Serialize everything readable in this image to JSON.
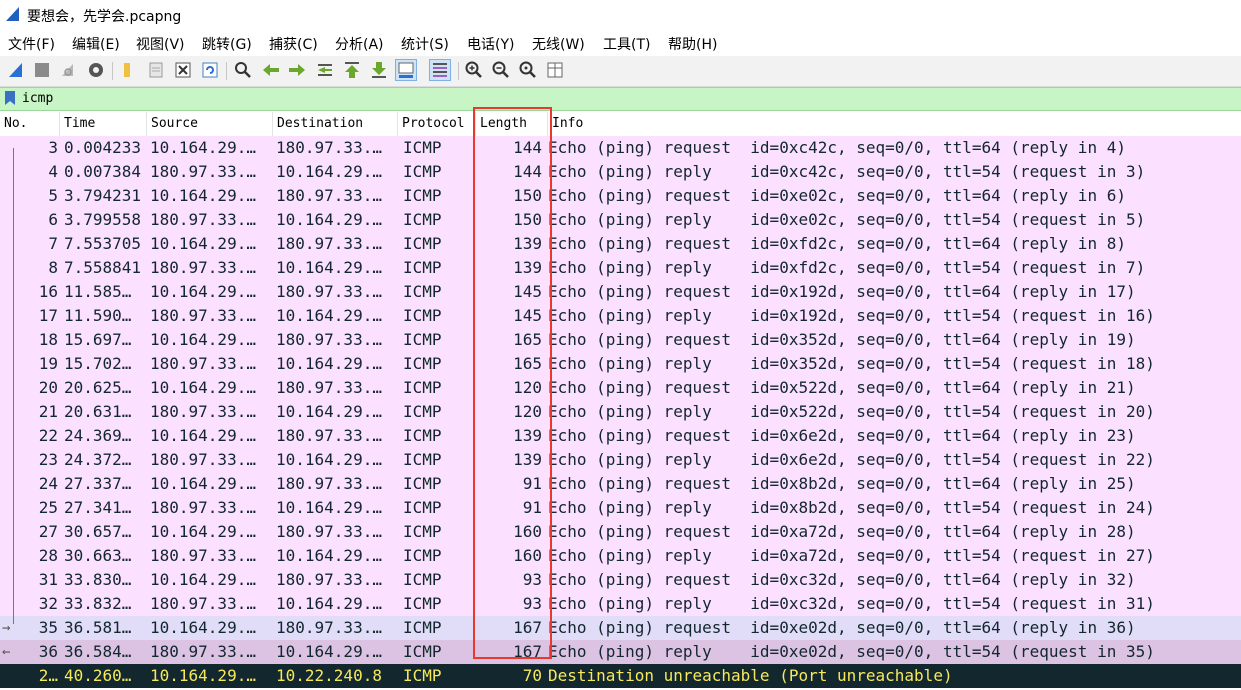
{
  "window": {
    "title": "要想会，先学会.pcapng",
    "icon": "wireshark-fin-icon"
  },
  "menu": [
    {
      "label": "文件(F)"
    },
    {
      "label": "编辑(E)"
    },
    {
      "label": "视图(V)"
    },
    {
      "label": "跳转(G)"
    },
    {
      "label": "捕获(C)"
    },
    {
      "label": "分析(A)"
    },
    {
      "label": "统计(S)"
    },
    {
      "label": "电话(Y)"
    },
    {
      "label": "无线(W)"
    },
    {
      "label": "工具(T)"
    },
    {
      "label": "帮助(H)"
    }
  ],
  "toolbar": {
    "icons": [
      "start-capture-icon",
      "stop-capture-icon",
      "restart-capture-icon",
      "capture-options-icon",
      "open-file-icon",
      "save-file-icon",
      "close-file-icon",
      "reload-file-icon",
      "find-packet-icon",
      "go-back-icon",
      "go-forward-icon",
      "go-to-packet-icon",
      "first-packet-icon",
      "last-packet-icon",
      "auto-scroll-icon",
      "colorize-icon",
      "zoom-in-icon",
      "zoom-out-icon",
      "zoom-normal-icon",
      "resize-columns-icon"
    ]
  },
  "filter": {
    "value": "icmp",
    "icon": "bookmark-icon"
  },
  "columns": {
    "no": "No.",
    "time": "Time",
    "source": "Source",
    "destination": "Destination",
    "protocol": "Protocol",
    "length": "Length",
    "info": "Info"
  },
  "colors": {
    "icmp_row": "#fce0ff",
    "selected_row": "#e1dcf8",
    "selected_row2": "#dcc3e3",
    "dark_row_bg": "#12272e",
    "dark_row_fg": "#f7e95a",
    "highlight_box": "#e8392c",
    "filter_bg": "#c7f5c5"
  },
  "packets": [
    {
      "no": "3",
      "time": "0.004233",
      "src": "10.164.29.…",
      "dst": "180.97.33.…",
      "proto": "ICMP",
      "len": "144",
      "info": "Echo (ping) request  id=0xc42c, seq=0/0, ttl=64 (reply in 4)",
      "style": "icmp"
    },
    {
      "no": "4",
      "time": "0.007384",
      "src": "180.97.33.…",
      "dst": "10.164.29.…",
      "proto": "ICMP",
      "len": "144",
      "info": "Echo (ping) reply    id=0xc42c, seq=0/0, ttl=54 (request in 3)",
      "style": "icmp"
    },
    {
      "no": "5",
      "time": "3.794231",
      "src": "10.164.29.…",
      "dst": "180.97.33.…",
      "proto": "ICMP",
      "len": "150",
      "info": "Echo (ping) request  id=0xe02c, seq=0/0, ttl=64 (reply in 6)",
      "style": "icmp"
    },
    {
      "no": "6",
      "time": "3.799558",
      "src": "180.97.33.…",
      "dst": "10.164.29.…",
      "proto": "ICMP",
      "len": "150",
      "info": "Echo (ping) reply    id=0xe02c, seq=0/0, ttl=54 (request in 5)",
      "style": "icmp"
    },
    {
      "no": "7",
      "time": "7.553705",
      "src": "10.164.29.…",
      "dst": "180.97.33.…",
      "proto": "ICMP",
      "len": "139",
      "info": "Echo (ping) request  id=0xfd2c, seq=0/0, ttl=64 (reply in 8)",
      "style": "icmp"
    },
    {
      "no": "8",
      "time": "7.558841",
      "src": "180.97.33.…",
      "dst": "10.164.29.…",
      "proto": "ICMP",
      "len": "139",
      "info": "Echo (ping) reply    id=0xfd2c, seq=0/0, ttl=54 (request in 7)",
      "style": "icmp"
    },
    {
      "no": "16",
      "time": "11.585…",
      "src": "10.164.29.…",
      "dst": "180.97.33.…",
      "proto": "ICMP",
      "len": "145",
      "info": "Echo (ping) request  id=0x192d, seq=0/0, ttl=64 (reply in 17)",
      "style": "icmp"
    },
    {
      "no": "17",
      "time": "11.590…",
      "src": "180.97.33.…",
      "dst": "10.164.29.…",
      "proto": "ICMP",
      "len": "145",
      "info": "Echo (ping) reply    id=0x192d, seq=0/0, ttl=54 (request in 16)",
      "style": "icmp"
    },
    {
      "no": "18",
      "time": "15.697…",
      "src": "10.164.29.…",
      "dst": "180.97.33.…",
      "proto": "ICMP",
      "len": "165",
      "info": "Echo (ping) request  id=0x352d, seq=0/0, ttl=64 (reply in 19)",
      "style": "icmp"
    },
    {
      "no": "19",
      "time": "15.702…",
      "src": "180.97.33.…",
      "dst": "10.164.29.…",
      "proto": "ICMP",
      "len": "165",
      "info": "Echo (ping) reply    id=0x352d, seq=0/0, ttl=54 (request in 18)",
      "style": "icmp"
    },
    {
      "no": "20",
      "time": "20.625…",
      "src": "10.164.29.…",
      "dst": "180.97.33.…",
      "proto": "ICMP",
      "len": "120",
      "info": "Echo (ping) request  id=0x522d, seq=0/0, ttl=64 (reply in 21)",
      "style": "icmp"
    },
    {
      "no": "21",
      "time": "20.631…",
      "src": "180.97.33.…",
      "dst": "10.164.29.…",
      "proto": "ICMP",
      "len": "120",
      "info": "Echo (ping) reply    id=0x522d, seq=0/0, ttl=54 (request in 20)",
      "style": "icmp"
    },
    {
      "no": "22",
      "time": "24.369…",
      "src": "10.164.29.…",
      "dst": "180.97.33.…",
      "proto": "ICMP",
      "len": "139",
      "info": "Echo (ping) request  id=0x6e2d, seq=0/0, ttl=64 (reply in 23)",
      "style": "icmp"
    },
    {
      "no": "23",
      "time": "24.372…",
      "src": "180.97.33.…",
      "dst": "10.164.29.…",
      "proto": "ICMP",
      "len": "139",
      "info": "Echo (ping) reply    id=0x6e2d, seq=0/0, ttl=54 (request in 22)",
      "style": "icmp"
    },
    {
      "no": "24",
      "time": "27.337…",
      "src": "10.164.29.…",
      "dst": "180.97.33.…",
      "proto": "ICMP",
      "len": "91",
      "info": "Echo (ping) request  id=0x8b2d, seq=0/0, ttl=64 (reply in 25)",
      "style": "icmp"
    },
    {
      "no": "25",
      "time": "27.341…",
      "src": "180.97.33.…",
      "dst": "10.164.29.…",
      "proto": "ICMP",
      "len": "91",
      "info": "Echo (ping) reply    id=0x8b2d, seq=0/0, ttl=54 (request in 24)",
      "style": "icmp"
    },
    {
      "no": "27",
      "time": "30.657…",
      "src": "10.164.29.…",
      "dst": "180.97.33.…",
      "proto": "ICMP",
      "len": "160",
      "info": "Echo (ping) request  id=0xa72d, seq=0/0, ttl=64 (reply in 28)",
      "style": "icmp"
    },
    {
      "no": "28",
      "time": "30.663…",
      "src": "180.97.33.…",
      "dst": "10.164.29.…",
      "proto": "ICMP",
      "len": "160",
      "info": "Echo (ping) reply    id=0xa72d, seq=0/0, ttl=54 (request in 27)",
      "style": "icmp"
    },
    {
      "no": "31",
      "time": "33.830…",
      "src": "10.164.29.…",
      "dst": "180.97.33.…",
      "proto": "ICMP",
      "len": "93",
      "info": "Echo (ping) request  id=0xc32d, seq=0/0, ttl=64 (reply in 32)",
      "style": "icmp"
    },
    {
      "no": "32",
      "time": "33.832…",
      "src": "180.97.33.…",
      "dst": "10.164.29.…",
      "proto": "ICMP",
      "len": "93",
      "info": "Echo (ping) reply    id=0xc32d, seq=0/0, ttl=54 (request in 31)",
      "style": "icmp"
    },
    {
      "no": "35",
      "time": "36.581…",
      "src": "10.164.29.…",
      "dst": "180.97.33.…",
      "proto": "ICMP",
      "len": "167",
      "info": "Echo (ping) request  id=0xe02d, seq=0/0, ttl=64 (reply in 36)",
      "style": "related"
    },
    {
      "no": "36",
      "time": "36.584…",
      "src": "180.97.33.…",
      "dst": "10.164.29.…",
      "proto": "ICMP",
      "len": "167",
      "info": "Echo (ping) reply    id=0xe02d, seq=0/0, ttl=54 (request in 35)",
      "style": "selected"
    },
    {
      "no": "2…",
      "time": "40.260…",
      "src": "10.164.29.…",
      "dst": "10.22.240.8",
      "proto": "ICMP",
      "len": "70",
      "info": "Destination unreachable (Port unreachable)",
      "style": "error"
    }
  ]
}
